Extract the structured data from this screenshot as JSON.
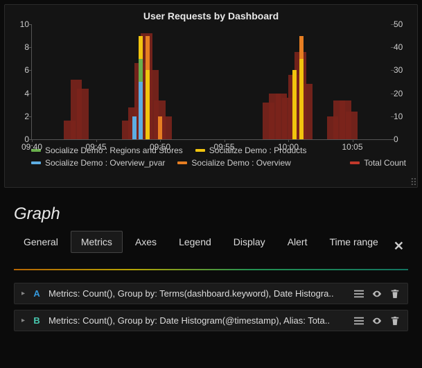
{
  "chart_data": {
    "type": "bar",
    "title": "User Requests by Dashboard",
    "x_ticks": [
      "09:40",
      "09:45",
      "09:50",
      "09:55",
      "10:00",
      "10:05"
    ],
    "y_left": {
      "min": 0,
      "max": 10,
      "ticks": [
        0,
        2,
        4,
        6,
        8,
        10
      ]
    },
    "y_right": {
      "min": 0,
      "max": 50,
      "ticks": [
        0,
        10,
        20,
        30,
        40,
        50
      ]
    },
    "legend": [
      {
        "name": "Socialize Demo : Regions and Stores",
        "color": "#6ab04c"
      },
      {
        "name": "Socialize Demo : Products",
        "color": "#f1c40f"
      },
      {
        "name": "Socialize Demo : Overview_pvar",
        "color": "#5dade2"
      },
      {
        "name": "Socialize Demo : Overview",
        "color": "#e67e22"
      },
      {
        "name": "Total Count",
        "color": "#c0392b"
      }
    ],
    "total_count": {
      "axis": "right",
      "series": [
        {
          "t": "09:43",
          "v": 8
        },
        {
          "t": "09:43.5",
          "v": 26
        },
        {
          "t": "09:44",
          "v": 22
        },
        {
          "t": "09:47.5",
          "v": 8
        },
        {
          "t": "09:48",
          "v": 14
        },
        {
          "t": "09:48.5",
          "v": 33
        },
        {
          "t": "09:49",
          "v": 46
        },
        {
          "t": "09:49.5",
          "v": 30
        },
        {
          "t": "09:50",
          "v": 17
        },
        {
          "t": "09:50.5",
          "v": 10
        },
        {
          "t": "09:58.5",
          "v": 16
        },
        {
          "t": "09:59",
          "v": 20
        },
        {
          "t": "09:59.5",
          "v": 20
        },
        {
          "t": "10:00",
          "v": 18
        },
        {
          "t": "10:00.5",
          "v": 28
        },
        {
          "t": "10:01",
          "v": 38
        },
        {
          "t": "10:01.5",
          "v": 24
        },
        {
          "t": "10:03.5",
          "v": 10
        },
        {
          "t": "10:04",
          "v": 17
        },
        {
          "t": "10:04.5",
          "v": 17
        },
        {
          "t": "10:05",
          "v": 12
        }
      ]
    },
    "stacked": {
      "axis": "left",
      "bins": [
        {
          "t": "09:48",
          "segments": [
            {
              "series": "Socialize Demo : Overview_pvar",
              "v": 2
            }
          ]
        },
        {
          "t": "09:48.5",
          "segments": [
            {
              "series": "Socialize Demo : Overview_pvar",
              "v": 5
            },
            {
              "series": "Socialize Demo : Regions and Stores",
              "v": 2
            },
            {
              "series": "Socialize Demo : Products",
              "v": 2
            }
          ]
        },
        {
          "t": "09:49",
          "segments": [
            {
              "series": "Socialize Demo : Products",
              "v": 6
            },
            {
              "series": "Socialize Demo : Overview",
              "v": 3
            }
          ]
        },
        {
          "t": "09:50",
          "segments": [
            {
              "series": "Socialize Demo : Overview",
              "v": 2
            }
          ]
        },
        {
          "t": "10:00.5",
          "segments": [
            {
              "series": "Socialize Demo : Products",
              "v": 6
            }
          ]
        },
        {
          "t": "10:01",
          "segments": [
            {
              "series": "Socialize Demo : Products",
              "v": 7
            },
            {
              "series": "Socialize Demo : Overview",
              "v": 2
            }
          ]
        }
      ]
    }
  },
  "editor": {
    "heading": "Graph",
    "tabs": [
      "General",
      "Metrics",
      "Axes",
      "Legend",
      "Display",
      "Alert",
      "Time range"
    ],
    "active_tab": "Metrics",
    "close_label": "✕",
    "queries": [
      {
        "id": "A",
        "color": "#3498db",
        "text": "Metrics: Count(), Group by: Terms(dashboard.keyword), Date Histogra.."
      },
      {
        "id": "B",
        "color": "#48c9b0",
        "text": "Metrics: Count(), Group by: Date Histogram(@timestamp), Alias: Tota.."
      }
    ],
    "row_icons": [
      "menu",
      "eye",
      "trash"
    ]
  }
}
